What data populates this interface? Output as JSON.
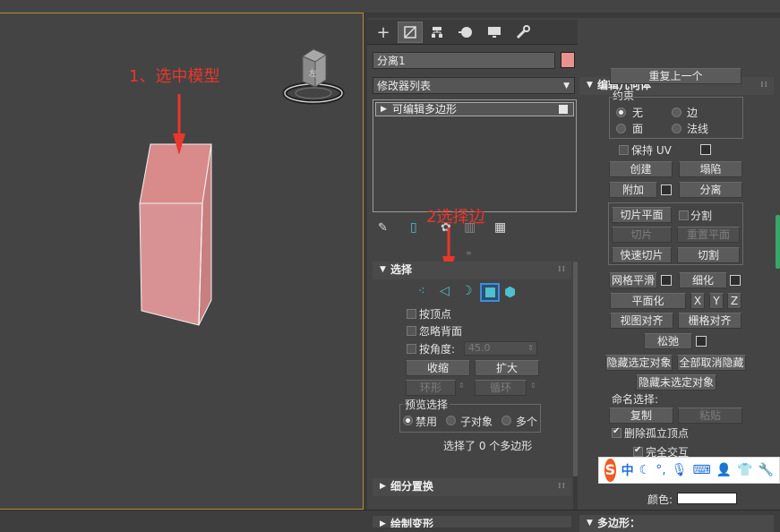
{
  "viewport": {
    "annotation_step1": "1、选中模型",
    "annotation_step2": "2选择边"
  },
  "command_panel": {
    "tabs": [
      {
        "icon": "create-plus-icon"
      },
      {
        "icon": "modify-icon",
        "active": true
      },
      {
        "icon": "hierarchy-icon"
      },
      {
        "icon": "motion-icon"
      },
      {
        "icon": "display-icon"
      },
      {
        "icon": "utilities-wrench-icon"
      }
    ],
    "object_name": "分离1",
    "object_color": "#e8928f",
    "modifier_list": "修改器列表",
    "modifier_stack": [
      "可编辑多边形"
    ]
  },
  "selection": {
    "title": "选择",
    "by_vertex": "按顶点",
    "ignore_backfacing": "忽略背面",
    "by_angle": "按角度:",
    "angle_value": "45.0",
    "shrink": "收缩",
    "grow": "扩大",
    "ring": "环形",
    "loop": "循环",
    "preview_title": "预览选择",
    "preview_off": "禁用",
    "preview_subobj": "子对象",
    "preview_multi": "多个",
    "status": "选择了 0 个多边形"
  },
  "rollouts_lower": {
    "subdivision_displacement": "细分置换",
    "paint_deformation": "绘制变形"
  },
  "edit_geometry": {
    "title": "编辑几何体",
    "repeat_last": "重复上一个",
    "constraints_title": "约束",
    "c_none": "无",
    "c_edge": "边",
    "c_face": "面",
    "c_normal": "法线",
    "preserve_uv": "保持 UV",
    "create": "创建",
    "collapse": "塌陷",
    "attach": "附加",
    "detach": "分离",
    "slice_plane": "切片平面",
    "split": "分割",
    "slice": "切片",
    "reset_plane": "重置平面",
    "quickslice": "快速切片",
    "cut": "切割",
    "meshsmooth": "网格平滑",
    "tessellate": "细化",
    "make_planar": "平面化",
    "x": "X",
    "y": "Y",
    "z": "Z",
    "view_align": "视图对齐",
    "grid_align": "栅格对齐",
    "relax": "松弛",
    "hide_selected": "隐藏选定对象",
    "unhide_all": "全部取消隐藏",
    "hide_unselected": "隐藏未选定对象",
    "named_sel": "命名选择:",
    "copy": "复制",
    "paste": "粘贴",
    "delete_isolated": "删除孤立顶点",
    "full_interactivity": "完全交互"
  },
  "polygon_material": {
    "title_partial": "多边形：",
    "color_label": "颜色:"
  },
  "ime": {
    "logo": "S",
    "mode": "中"
  }
}
